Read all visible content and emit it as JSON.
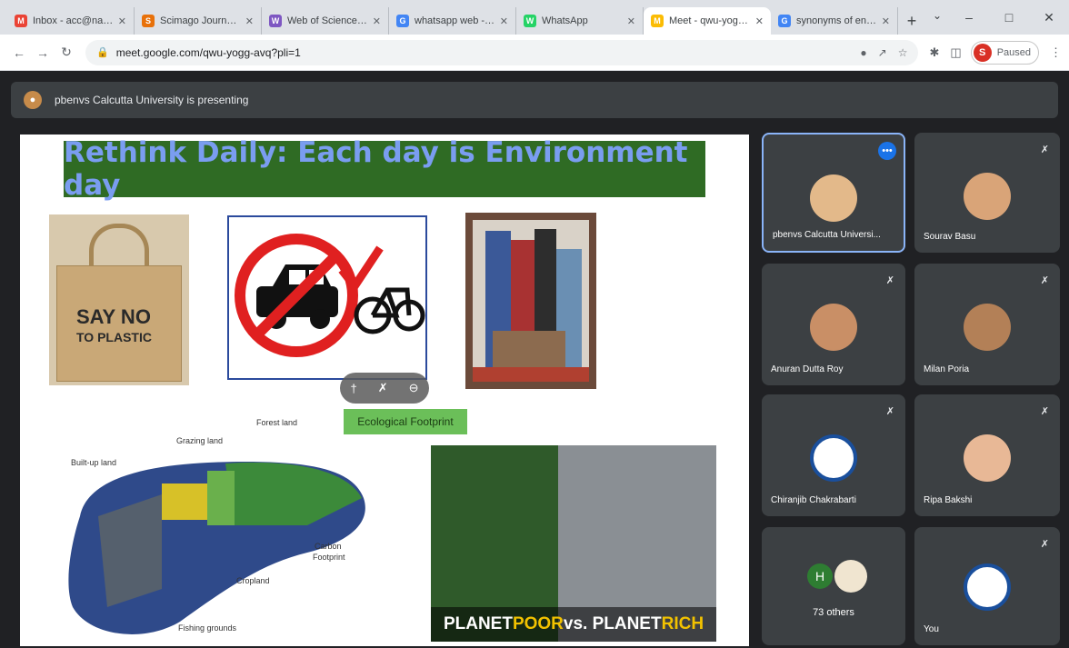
{
  "browser": {
    "tabs": [
      {
        "title": "Inbox - acc@nagendr...",
        "fav_color": "#ea4335",
        "fav_glyph": "M"
      },
      {
        "title": "Scimago Journal & C...",
        "fav_color": "#e8710a",
        "fav_glyph": "S"
      },
      {
        "title": "Web of Science Mast...",
        "fav_color": "#7e57c2",
        "fav_glyph": "W"
      },
      {
        "title": "whatsapp web - Goo...",
        "fav_color": "#4285f4",
        "fav_glyph": "G"
      },
      {
        "title": "WhatsApp",
        "fav_color": "#25d366",
        "fav_glyph": "W"
      },
      {
        "title": "Meet - qwu-yogg-...",
        "fav_color": "#fbbc04",
        "fav_glyph": "M"
      },
      {
        "title": "synonyms of endange...",
        "fav_color": "#4285f4",
        "fav_glyph": "G"
      }
    ],
    "url": "meet.google.com/qwu-yogg-avq?pli=1",
    "profile_initial": "S",
    "profile_label": "Paused"
  },
  "meet": {
    "presenting_text": "pbenvs Calcutta University is presenting",
    "participants": [
      {
        "name": "pbenvs Calcutta Universi...",
        "skin": "#e3b98a"
      },
      {
        "name": "Sourav Basu",
        "skin": "#d9a478"
      },
      {
        "name": "Anuran Dutta Roy",
        "skin": "#c98f66"
      },
      {
        "name": "Milan Poria",
        "skin": "#b38057"
      },
      {
        "name": "Chiranjib Chakrabarti",
        "skin": "#1a4f9c"
      },
      {
        "name": "Ripa Bakshi",
        "skin": "#e8b896"
      }
    ],
    "others_initial": "H",
    "others_count": "73 others",
    "self_name": "You"
  },
  "slide": {
    "title": "Rethink Daily: Each day is Environment day",
    "bag_line1": "SAY NO",
    "bag_line2": "TO PLASTIC",
    "eco_label": "Ecological Footprint",
    "foot_labels": {
      "forest": "Forest land",
      "grazing": "Grazing land",
      "builtup": "Built-up land",
      "carbon1": "Carbon",
      "carbon2": "Footprint",
      "cropland": "Cropland",
      "fishing": "Fishing grounds"
    },
    "aerial_caption_parts": [
      "PLANET ",
      "POOR",
      " vs. PLANET ",
      "RICH"
    ]
  },
  "colors": {
    "meet_bg": "#202124",
    "tile_bg": "#3c4043",
    "slide_title_bg": "#2f6b24",
    "slide_title_text": "#7a9df0",
    "eco_label_bg": "#6bbf59",
    "active_tile_border": "#8ab4f8"
  }
}
